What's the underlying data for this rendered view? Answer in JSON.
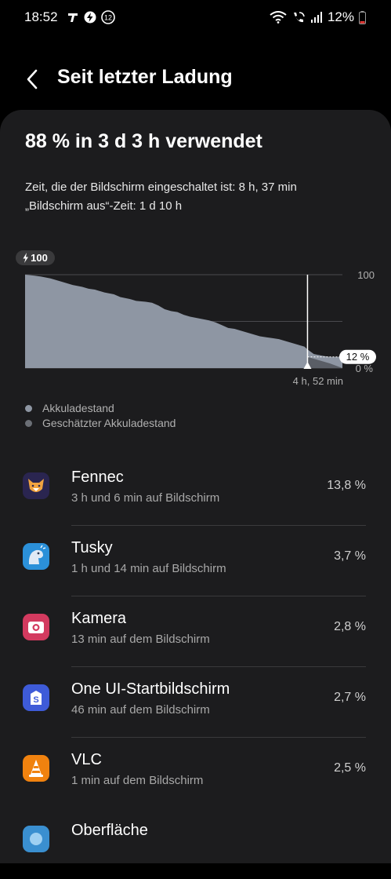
{
  "status_bar": {
    "time": "18:52",
    "notification_badge": "12",
    "battery": "12%"
  },
  "header": {
    "back_icon": "chevron-left-icon",
    "title": "Seit letzter Ladung"
  },
  "summary": {
    "usage": "88 % in 3 d 3 h verwendet",
    "screen_on": "Zeit, die der Bildschirm eingeschaltet ist: 8 h, 37 min",
    "screen_off": "„Bildschirm aus“-Zeit: 1 d 10 h"
  },
  "chart_data": {
    "type": "area",
    "x": [
      0,
      3,
      5,
      8,
      10,
      12,
      15,
      18,
      20,
      22,
      25,
      28,
      30,
      33,
      35,
      38,
      40,
      42,
      44,
      46,
      48,
      50,
      52,
      55,
      58,
      60,
      62,
      64,
      66,
      68,
      70,
      72,
      74,
      76,
      78,
      80,
      82,
      84,
      86,
      88,
      89,
      91,
      94,
      96,
      100
    ],
    "values": [
      100,
      99,
      98,
      96,
      94,
      92,
      89,
      87,
      85,
      84,
      81,
      79,
      76,
      74,
      72,
      71,
      70,
      67,
      63,
      61,
      60,
      57,
      55,
      53,
      51,
      49,
      46,
      43,
      42,
      40,
      38,
      36,
      34,
      33,
      32,
      31,
      29,
      27,
      25,
      23,
      20,
      15,
      13,
      12,
      12
    ],
    "projected_x": [
      89,
      96,
      100
    ],
    "projected_values": [
      12,
      5,
      0
    ],
    "ylim": [
      0,
      100
    ],
    "y_ticks": [
      "100",
      "0 %"
    ],
    "start_label": "100",
    "current_label": "12 %",
    "remaining_label": "4 h, 52 min",
    "series_colors": {
      "battery": "#8e96a3",
      "estimated": "#5a5e66"
    }
  },
  "legend": [
    {
      "label": "Akkuladestand",
      "color": "#8e96a3"
    },
    {
      "label": "Geschätzter Akkuladestand",
      "color": "#6b6f76"
    }
  ],
  "apps": [
    {
      "name": "Fennec",
      "detail": "3 h und 6 min auf Bildschirm",
      "percent": "13,8 %",
      "icon": "fennec-fox-icon",
      "color": "#2a2550"
    },
    {
      "name": "Tusky",
      "detail": "1 h und 14 min auf Bildschirm",
      "percent": "3,7 %",
      "icon": "tusky-mastodon-icon",
      "color": "#2b90d9"
    },
    {
      "name": "Kamera",
      "detail": "13 min auf dem Bildschirm",
      "percent": "2,8 %",
      "icon": "camera-icon",
      "color": "#d33a5f"
    },
    {
      "name": "One UI-Startbildschirm",
      "detail": "46 min auf dem Bildschirm",
      "percent": "2,7 %",
      "icon": "home-screen-icon",
      "color": "#3e5bd8"
    },
    {
      "name": "VLC",
      "detail": "1 min auf dem Bildschirm",
      "percent": "2,5 %",
      "icon": "vlc-cone-icon",
      "color": "#f0820f"
    },
    {
      "name": "Oberfläche",
      "detail": "",
      "percent": "",
      "icon": "system-ui-icon",
      "color": "#3a8fd0"
    }
  ]
}
